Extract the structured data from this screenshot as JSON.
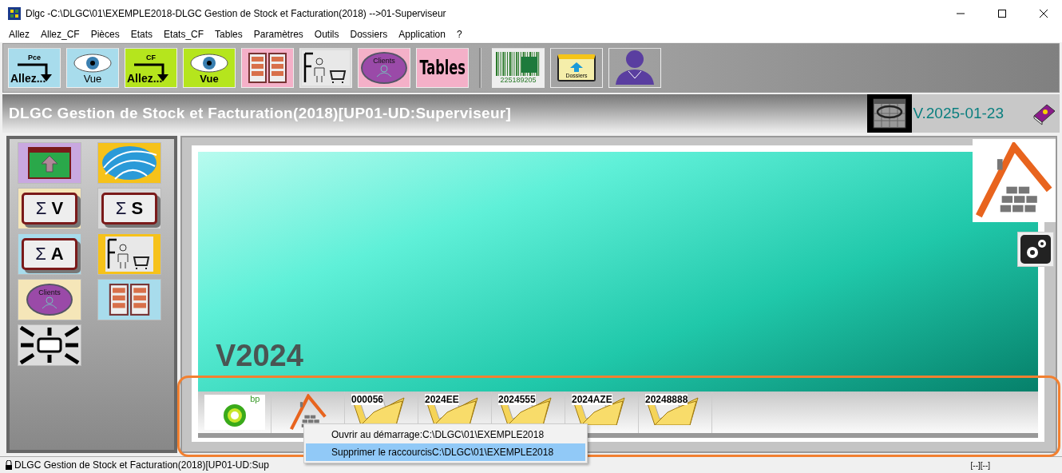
{
  "window": {
    "title": "Dlgc -C:\\DLGC\\01\\EXEMPLE2018-DLGC Gestion de Stock et Facturation(2018) -->01-Superviseur"
  },
  "menu": [
    "Allez",
    "Allez_CF",
    "Pièces",
    "Etats",
    "Etats_CF",
    "Tables",
    "Paramètres",
    "Outils",
    "Dossiers",
    "Application",
    "?"
  ],
  "toolbar": [
    {
      "kind": "goto",
      "small": "Pce",
      "label": "Allez...",
      "color": "#a8dcec"
    },
    {
      "kind": "view",
      "label": "Vue",
      "color": "#a8dcec"
    },
    {
      "kind": "goto",
      "small": "CF",
      "label": "Allez...",
      "color": "#b5e51d"
    },
    {
      "kind": "view",
      "label": "Vue",
      "color": "#b5e51d"
    },
    {
      "kind": "grid"
    },
    {
      "kind": "person_cart"
    },
    {
      "kind": "clients",
      "label": "Clients"
    },
    {
      "kind": "tables",
      "label": "Tables"
    },
    {
      "kind": "barcode",
      "label": "225189205"
    },
    {
      "kind": "folder",
      "label": "Dossiers"
    },
    {
      "kind": "doctor"
    }
  ],
  "header": {
    "title": "DLGC Gestion de Stock et Facturation(2018)[UP01-UD:Superviseur]",
    "version": "V.2025-01-23"
  },
  "side_panel": [
    {
      "kind": "upload"
    },
    {
      "kind": "globe"
    },
    {
      "kind": "sigma",
      "sigma": "Σ",
      "letter": "V",
      "color": "#f5e6b8"
    },
    {
      "kind": "sigma",
      "sigma": "Σ",
      "letter": "S",
      "color": "#d8d8d8"
    },
    {
      "kind": "sigma",
      "sigma": "Σ",
      "letter": "A",
      "color": "#a8dcec"
    },
    {
      "kind": "person_cart"
    },
    {
      "kind": "clients",
      "label": "Clients"
    },
    {
      "kind": "grid"
    },
    {
      "kind": "arrows"
    }
  ],
  "banner": {
    "watermark": "V2024"
  },
  "shortcuts": [
    {
      "kind": "bp",
      "label": "bp"
    },
    {
      "kind": "house"
    },
    {
      "kind": "folder",
      "label": "000056"
    },
    {
      "kind": "folder",
      "label": "2024EE"
    },
    {
      "kind": "folder",
      "label": "2024555"
    },
    {
      "kind": "folder",
      "label": "2024AZE"
    },
    {
      "kind": "folder",
      "label": "20248888"
    }
  ],
  "context_menu": [
    {
      "label": "Ouvrir au démarrage:C:\\DLGC\\01\\EXEMPLE2018",
      "selected": false
    },
    {
      "label": "Supprimer le raccourcisC:\\DLGC\\01\\EXEMPLE2018",
      "selected": true
    }
  ],
  "status_bar": {
    "text": "DLGC Gestion de Stock et Facturation(2018)[UP01-UD:Sup",
    "right": "[--][--]"
  }
}
